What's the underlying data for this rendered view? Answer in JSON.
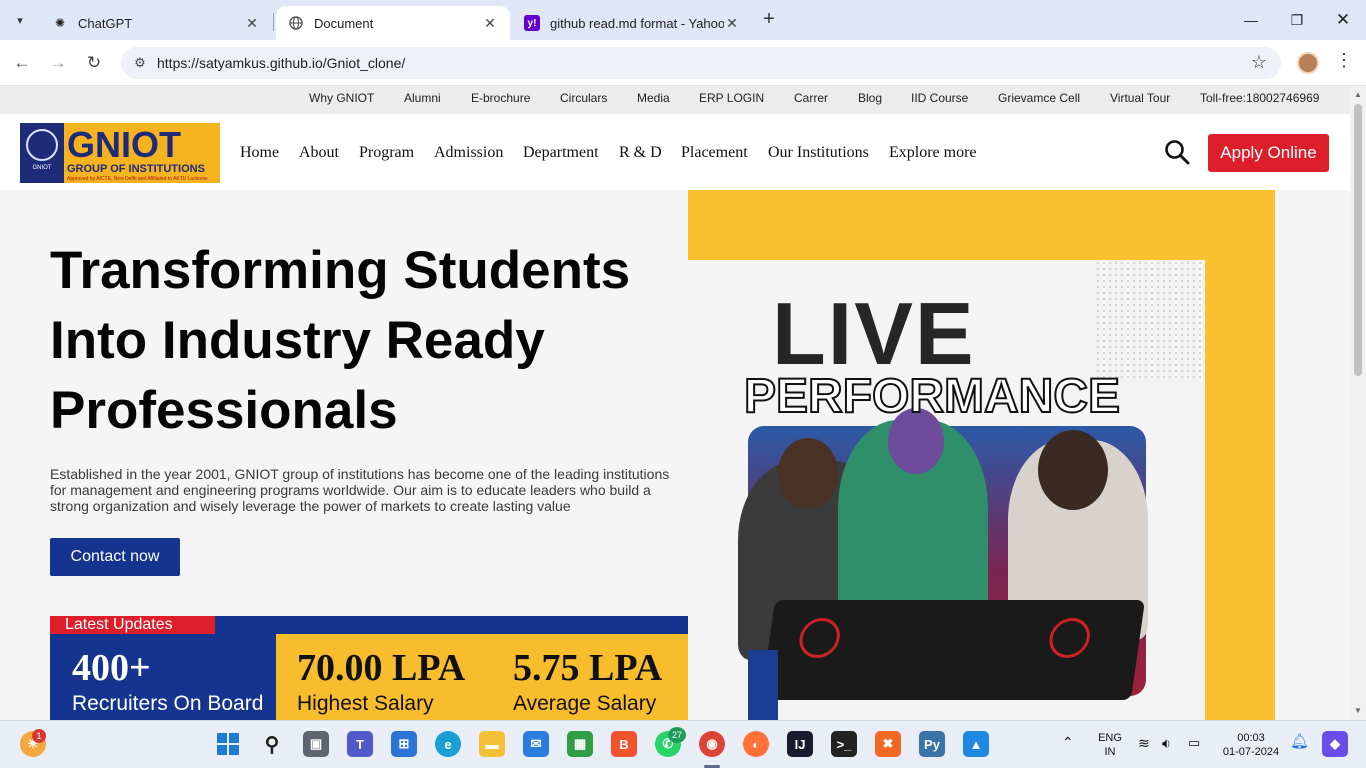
{
  "browser": {
    "tabs": [
      {
        "title": "ChatGPT",
        "icon": "chatgpt-icon"
      },
      {
        "title": "Document",
        "icon": "globe-icon"
      },
      {
        "title": "github read.md format - Yahoo",
        "icon": "yahoo-icon"
      }
    ],
    "url": "https://satyamkus.github.io/Gniot_clone/"
  },
  "topstrip": [
    "Why GNIOT",
    "Alumni",
    "E-brochure",
    "Circulars",
    "Media",
    "ERP LOGIN",
    "Carrer",
    "Blog",
    "IID Course",
    "Grievamce Cell",
    "Virtual Tour",
    "Toll-free:18002746969"
  ],
  "logo": {
    "big": "GNIOT",
    "sub": "GROUP OF INSTITUTIONS",
    "tiny": "Approved by AICTE, New Delhi and Affiliated to AKTU Lucknow",
    "seal": "GNIOT"
  },
  "nav": [
    "Home",
    "About",
    "Program",
    "Admission",
    "Department",
    "R & D",
    "Placement",
    "Our Institutions",
    "Explore more"
  ],
  "apply_label": "Apply Online",
  "hero": {
    "title_lines": [
      "Transforming Students",
      "Into Industry Ready",
      "Professionals"
    ],
    "description": "Established in the year 2001, GNIOT group of institutions has become one of the leading institutions for management and engineering programs worldwide. Our aim is to educate leaders who build a strong organization and wisely leverage the power of markets to create lasting value",
    "contact_label": "Contact now"
  },
  "updates_label": "Latest Updates",
  "stats": [
    {
      "value": "400+",
      "label": "Recruiters On Board"
    },
    {
      "value": "70.00 LPA",
      "label": "Highest Salary"
    },
    {
      "value": "5.75 LPA",
      "label": "Average Salary"
    }
  ],
  "poster": {
    "line1": "LIVE",
    "line2": "PERFORMANCE"
  },
  "taskbar": {
    "weather_badge": "1",
    "whatsapp_badge": "27",
    "lang_top": "ENG",
    "lang_bottom": "IN",
    "time": "00:03",
    "date": "01-07-2024"
  },
  "colors": {
    "brand_blue": "#14348f",
    "brand_red": "#dd1f2b",
    "brand_yellow": "#f8bd2c"
  }
}
